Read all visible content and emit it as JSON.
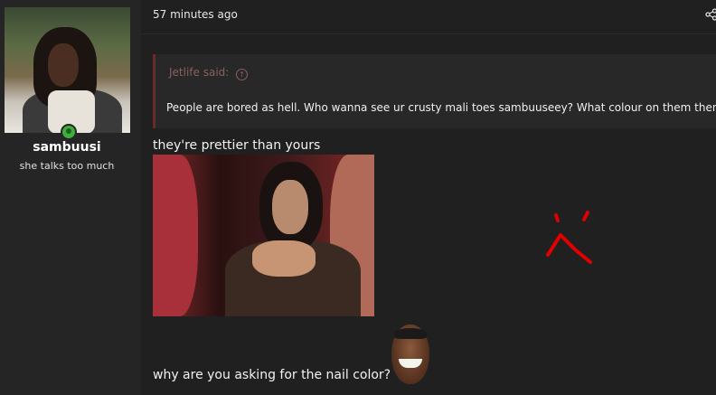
{
  "post": {
    "timestamp": "57 minutes ago"
  },
  "author": {
    "username": "sambuusi",
    "user_title": "she talks too much",
    "online": true
  },
  "quote": {
    "author_label": "Jetlife said:",
    "text": "People are bored as hell. Who wanna see ur crusty mali toes sambuuseey? What colour on them then?"
  },
  "messages": {
    "line1": "they're prettier than yours",
    "line2": "why are you asking for the nail color?"
  },
  "icons": {
    "share": "share-icon",
    "quote_jump": "arrow-up-circle-icon",
    "online": "online-status-icon"
  },
  "colors": {
    "background": "#202020",
    "sidebar": "#252525",
    "quote_border": "#6b2a2a",
    "drawing_red": "#e00000"
  }
}
